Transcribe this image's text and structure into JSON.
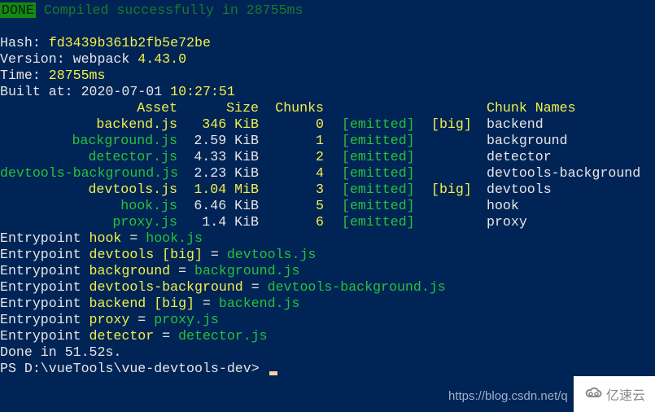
{
  "status": {
    "badge": "DONE",
    "message": "Compiled successfully in 28755ms"
  },
  "build_info": {
    "hash_label": "Hash: ",
    "hash": "fd3439b361b2fb5e72be",
    "version_label": "Version: webpack ",
    "version": "4.43.0",
    "time_label": "Time: ",
    "time": "28755ms",
    "built_label": "Built at: ",
    "built_date": "2020-07-01 ",
    "built_time": "10:27:51"
  },
  "table": {
    "headers": {
      "asset": "Asset",
      "size": "Size",
      "chunks": "Chunks",
      "chunk_names": "Chunk Names"
    },
    "rows": [
      {
        "asset": "backend.js",
        "size": "346 KiB",
        "chunks": "0",
        "emitted": "[emitted]",
        "big": "[big]",
        "chunk_name": "backend"
      },
      {
        "asset": "background.js",
        "size": "2.59 KiB",
        "chunks": "1",
        "emitted": "[emitted]",
        "big": "",
        "chunk_name": "background"
      },
      {
        "asset": "detector.js",
        "size": "4.33 KiB",
        "chunks": "2",
        "emitted": "[emitted]",
        "big": "",
        "chunk_name": "detector"
      },
      {
        "asset": "devtools-background.js",
        "size": "2.23 KiB",
        "chunks": "4",
        "emitted": "[emitted]",
        "big": "",
        "chunk_name": "devtools-background"
      },
      {
        "asset": "devtools.js",
        "size": "1.04 MiB",
        "chunks": "3",
        "emitted": "[emitted]",
        "big": "[big]",
        "chunk_name": "devtools"
      },
      {
        "asset": "hook.js",
        "size": "6.46 KiB",
        "chunks": "5",
        "emitted": "[emitted]",
        "big": "",
        "chunk_name": "hook"
      },
      {
        "asset": "proxy.js",
        "size": "1.4 KiB",
        "chunks": "6",
        "emitted": "[emitted]",
        "big": "",
        "chunk_name": "proxy"
      }
    ]
  },
  "entrypoints": {
    "label": "Entrypoint ",
    "equals": " = ",
    "items": [
      {
        "name": "hook",
        "big": "",
        "file": "hook.js"
      },
      {
        "name": "devtools",
        "big": " [big]",
        "file": "devtools.js"
      },
      {
        "name": "background",
        "big": "",
        "file": "background.js"
      },
      {
        "name": "devtools-background",
        "big": "",
        "file": "devtools-background.js"
      },
      {
        "name": "backend",
        "big": " [big]",
        "file": "backend.js"
      },
      {
        "name": "proxy",
        "big": "",
        "file": "proxy.js"
      },
      {
        "name": "detector",
        "big": "",
        "file": "detector.js"
      }
    ]
  },
  "done": "Done in 51.52s.",
  "prompt": "PS D:\\vueTools\\vue-devtools-dev>",
  "watermark": {
    "url": "https://blog.csdn.net/q",
    "brand": "亿速云",
    "icon": "cloud-logo-icon"
  }
}
